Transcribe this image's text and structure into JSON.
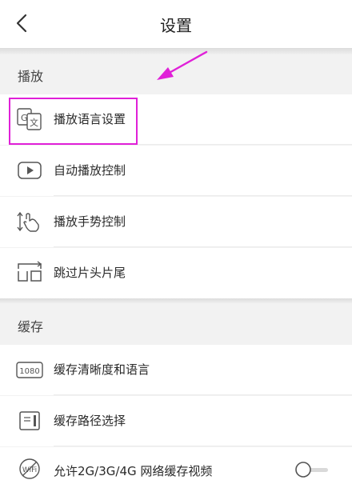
{
  "nav": {
    "title": "设置",
    "back_icon": "chevron-left-icon"
  },
  "sections": [
    {
      "header": "播放",
      "items": [
        {
          "label": "播放语言设置",
          "icon": "translate-icon"
        },
        {
          "label": "自动播放控制",
          "icon": "play-box-icon"
        },
        {
          "label": "播放手势控制",
          "icon": "gesture-swipe-icon"
        },
        {
          "label": "跳过片头片尾",
          "icon": "skip-intro-icon"
        }
      ]
    },
    {
      "header": "缓存",
      "items": [
        {
          "label": "缓存清晰度和语言",
          "icon": "resolution-1080-icon",
          "badge": "1080"
        },
        {
          "label": "缓存路径选择",
          "icon": "folder-path-icon"
        },
        {
          "label": "允许2G/3G/4G 网络缓存视频",
          "icon": "wifi-off-icon",
          "toggle": false
        }
      ]
    }
  ],
  "annotation": {
    "color": "#e020d8"
  }
}
